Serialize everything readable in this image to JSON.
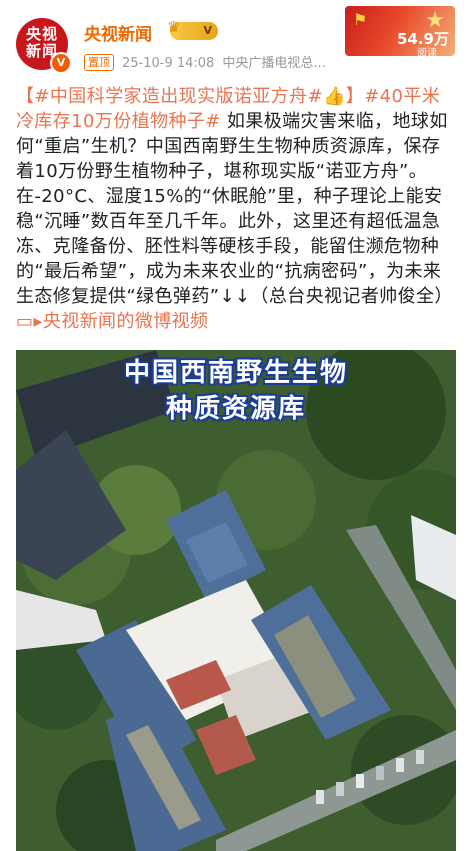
{
  "header": {
    "avatar_text_1": "央视",
    "avatar_text_2": "新闻",
    "verified_mark": "V",
    "account_name": "央视新闻",
    "level_badge": "V",
    "pinned_label": "置顶",
    "timestamp": "25-10-9 14:08",
    "source": "中央广播电视总...",
    "fans_count": "54.9万",
    "fans_label": "阅读"
  },
  "post": {
    "tag1": "【#中国科学家造出现实版诺亚方舟#👍】",
    "tag2": "#40平米冷库存10万份植物种子#",
    "body": " 如果极端灾害来临，地球如何“重启”生机？中国西南野生生物种质资源库，保存着10万份野生植物种子，堪称现实版“诺亚方舟”。在-20°C、湿度15%的“休眠舱”里，种子理论上能安稳“沉睡”数百年至几千年。此外，这里还有超低温急冻、克隆备份、胚性料等硬核手段，能留住濒危物种的“最后希望”，成为未来农业的“抗病密码”，为未来生态修复提供“绿色弹药”↓↓（总台央视记者帅俊全）",
    "video_link_icon": "video-link-icon",
    "video_link": "央视新闻的微博视频"
  },
  "media": {
    "caption_line1": "中国西南野生生物",
    "caption_line2": "种质资源库"
  },
  "colors": {
    "accent": "#f06a00",
    "link": "#eb7350",
    "avatar_red": "#c8161d"
  }
}
